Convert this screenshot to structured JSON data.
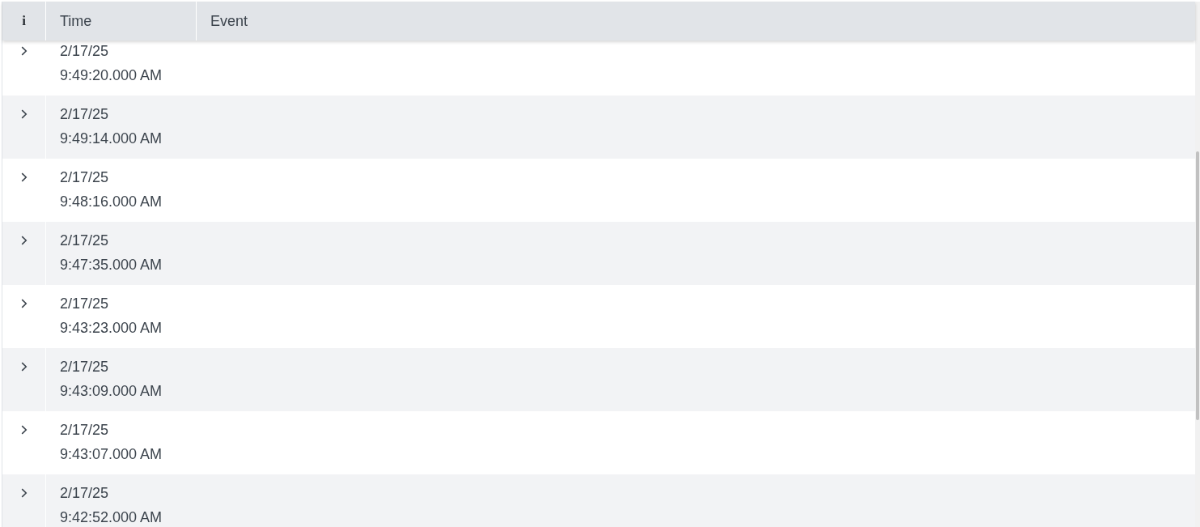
{
  "table": {
    "columns": [
      {
        "kind": "info",
        "label": "i"
      },
      {
        "kind": "text",
        "label": "Time"
      },
      {
        "kind": "text",
        "label": "Event"
      }
    ],
    "rows": [
      {
        "date": "2/17/25",
        "time": "9:49:20.000 AM",
        "expanded": false
      },
      {
        "date": "2/17/25",
        "time": "9:49:14.000 AM",
        "expanded": false
      },
      {
        "date": "2/17/25",
        "time": "9:48:16.000 AM",
        "expanded": false
      },
      {
        "date": "2/17/25",
        "time": "9:47:35.000 AM",
        "expanded": false
      },
      {
        "date": "2/17/25",
        "time": "9:43:23.000 AM",
        "expanded": false
      },
      {
        "date": "2/17/25",
        "time": "9:43:09.000 AM",
        "expanded": false
      },
      {
        "date": "2/17/25",
        "time": "9:43:07.000 AM",
        "expanded": false
      },
      {
        "date": "2/17/25",
        "time": "9:42:52.000 AM",
        "expanded": false
      }
    ]
  }
}
